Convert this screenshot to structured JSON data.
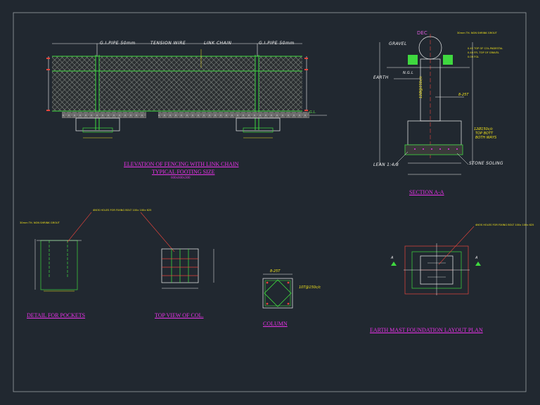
{
  "colors": {
    "background": "#212830",
    "title": "#e832e8",
    "line_white": "#f2f2f2",
    "line_green": "#3fd83f",
    "line_yellow": "#f2e31c",
    "line_red": "#e8453c",
    "line_cyan": "#38d8e0"
  },
  "elevation": {
    "title": "ELEVATION OF FENCING WITH LINK CHAIN",
    "subtitle": "TYPICAL FOOTING SIZE",
    "footing_size": "600x600x300",
    "labels": {
      "gi_pipe_left": "G.I.PIPE 50mm",
      "tension_wire": "TENSION WIRE",
      "link_chain": "LINK CHAIN",
      "gi_pipe_right": "G.I.PIPE 50mm",
      "ground_level": "G.L."
    }
  },
  "section": {
    "title": "SECTION A-A",
    "labels": {
      "dec": "DEC",
      "grout": "30mm TH. NON SHRINK GROUT",
      "gravel": "GRAVEL",
      "gravel_note_1": "0.45 TOP OF COL.PADESTAL",
      "gravel_note_2": "0.40 FFL TOP OF GRAVEL",
      "gravel_note_3": "0.00 FGL",
      "earth": "EARTH",
      "ngl": "N.G.L",
      "rebar_vertical": "12Ø@150c/c",
      "stirrup": "8-25T",
      "top_bot": "12Ø150c/c",
      "top_bot_2": "TOP BOTT",
      "both_ways": "BOTH WAYS",
      "lean": "LEAN 1:4:8",
      "stone_soling": "STONE SOLING"
    }
  },
  "pockets": {
    "title": "DETAIL FOR POCKETS",
    "grout": "30mm TH. NON SHRINK GROUT",
    "holes": "4NOS HOLES FOR FIXING BOLT 100x 100x 625"
  },
  "top_view": {
    "title": "TOP VIEW OF COL."
  },
  "column": {
    "title": "COLUMN",
    "stirrup": "8-25T",
    "rebar": "10T@150c/c"
  },
  "earth_mast": {
    "title": "EARTH MAST  FOUNDATION LAYOUT PLAN",
    "holes": "4NOS HOLES FOR FIXING BOLT 100x 100x 625",
    "marker_left": "A",
    "marker_right": "A"
  }
}
